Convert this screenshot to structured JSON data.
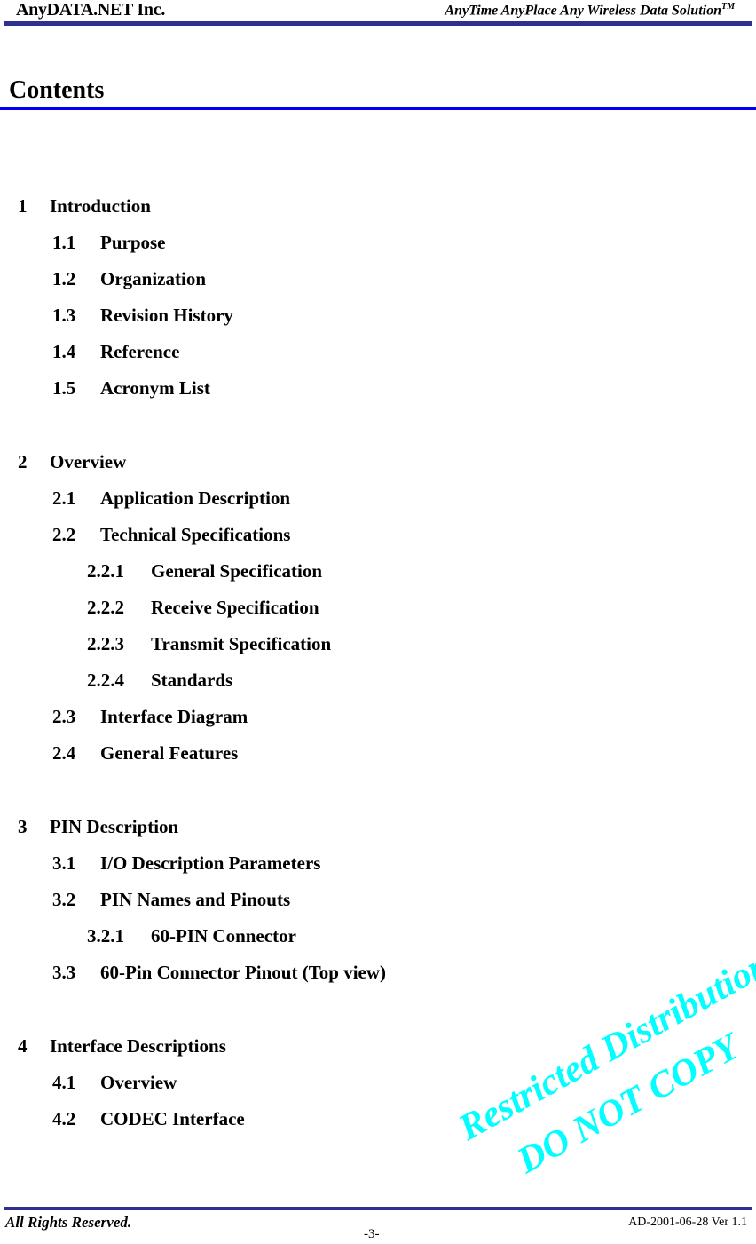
{
  "header": {
    "company": "AnyDATA.NET Inc.",
    "tagline": "AnyTime AnyPlace Any Wireless Data Solution",
    "tagline_mark": "TM"
  },
  "page_title": "Contents",
  "toc": [
    {
      "num": "1",
      "title": "Introduction",
      "level": 1
    },
    {
      "num": "1.1",
      "title": "Purpose",
      "level": 2
    },
    {
      "num": "1.2",
      "title": "Organization",
      "level": 2
    },
    {
      "num": "1.3",
      "title": "Revision History",
      "level": 2
    },
    {
      "num": "1.4",
      "title": "Reference",
      "level": 2
    },
    {
      "num": "1.5",
      "title": "Acronym List",
      "level": 2
    },
    {
      "num": "2",
      "title": "Overview",
      "level": 1
    },
    {
      "num": "2.1",
      "title": "Application Description",
      "level": 2
    },
    {
      "num": "2.2",
      "title": "Technical Specifications",
      "level": 2
    },
    {
      "num": "2.2.1",
      "title": "General Specification",
      "level": 3
    },
    {
      "num": "2.2.2",
      "title": "Receive Specification",
      "level": 3
    },
    {
      "num": "2.2.3",
      "title": "Transmit Specification",
      "level": 3
    },
    {
      "num": "2.2.4",
      "title": "Standards",
      "level": 3
    },
    {
      "num": "2.3",
      "title": "Interface Diagram",
      "level": 2
    },
    {
      "num": "2.4",
      "title": "General Features",
      "level": 2
    },
    {
      "num": "3",
      "title": "PIN Description",
      "level": 1
    },
    {
      "num": "3.1",
      "title": "I/O Description Parameters",
      "level": 2
    },
    {
      "num": "3.2",
      "title": "PIN Names and Pinouts",
      "level": 2
    },
    {
      "num": "3.2.1",
      "title": "60-PIN Connector",
      "level": 3
    },
    {
      "num": "3.3",
      "title": "60-Pin Connector Pinout (Top view)",
      "level": 2
    },
    {
      "num": "4",
      "title": "Interface Descriptions",
      "level": 1
    },
    {
      "num": "4.1",
      "title": "Overview",
      "level": 2
    },
    {
      "num": "4.2",
      "title": "CODEC Interface",
      "level": 2
    }
  ],
  "watermark": {
    "line1": "Restricted Distribution",
    "line2": "DO NOT COPY",
    "color": "#00ffff"
  },
  "footer": {
    "rights": "All Rights Reserved.",
    "doc_id": "AD-2001-06-28 Ver 1.1",
    "page_number": "-3-"
  },
  "colors": {
    "header_rule": "#2e3192",
    "contents_rule": "#0000ee"
  }
}
